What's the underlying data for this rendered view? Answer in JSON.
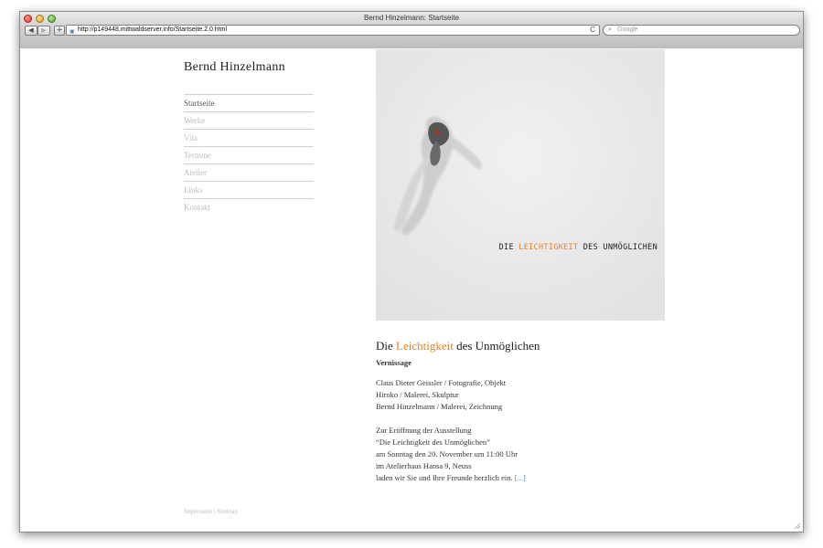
{
  "window": {
    "title": "Bernd Hinzelmann: Startseite",
    "url": "http://p149448.mittwaldserver.info/Startseite.2.0.html",
    "search_placeholder": "Google",
    "back_label": "◀",
    "forward_label": "▶",
    "add_label": "+",
    "reload_label": "C"
  },
  "site": {
    "title": "Bernd Hinzelmann"
  },
  "nav": [
    {
      "label": "Startseite"
    },
    {
      "label": "Werke"
    },
    {
      "label": "Vita"
    },
    {
      "label": "Termine"
    },
    {
      "label": "Atelier"
    },
    {
      "label": "Links"
    },
    {
      "label": "Kontakt"
    }
  ],
  "hero": {
    "caption_pre": "DIE ",
    "caption_accent": "LEICHTIGKEIT",
    "caption_post": " DES UNMÖGLICHEN"
  },
  "article": {
    "headline_pre": "Die ",
    "headline_accent": "Leichtigkeit",
    "headline_post": " des Unmöglichen",
    "subhead": "Vernissage",
    "artists": [
      "Claus Dieter Geissler / Fotografie, Objekt",
      "Hiroko / Malerei, Skulptur",
      "Bernd Hinzelmann / Malerei, Zeichnung"
    ],
    "invitation": [
      "Zur Eröffnung der Ausstellung",
      "“Die Leichtigkeit des Unmöglichen”",
      "am Sonntag den 20. November um 11:00 Uhr",
      "im Atelierhaus Hansa 9, Neuss",
      "laden wir Sie und Ihre Freunde herzlich ein."
    ],
    "more_link": "[...]"
  },
  "footer": {
    "impressum": "Impressum",
    "separator": "|",
    "sitemap": "Sitemap"
  },
  "colors": {
    "accent": "#e8832a",
    "link": "#2c8fc7",
    "nav_inactive": "#bdbdbd"
  }
}
